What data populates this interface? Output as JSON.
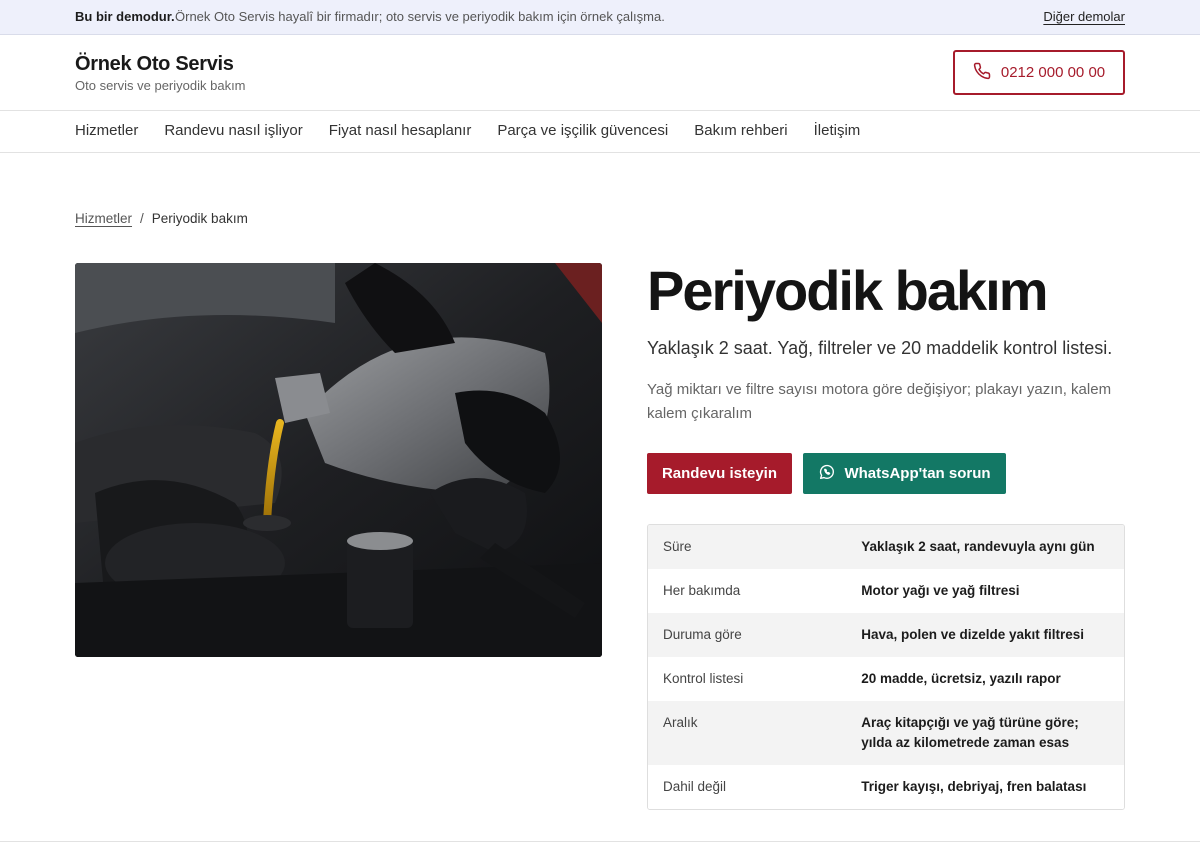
{
  "demo_bar": {
    "strong": "Bu bir demodur.",
    "note": "Örnek Oto Servis hayalî bir firmadır; oto servis ve periyodik bakım için örnek çalışma.",
    "other_link": "Diğer demolar"
  },
  "header": {
    "brand_title": "Örnek Oto Servis",
    "brand_sub": "Oto servis ve periyodik bakım",
    "phone": "0212 000 00 00",
    "phone_icon": "phone-icon"
  },
  "nav": {
    "items": [
      "Hizmetler",
      "Randevu nasıl işliyor",
      "Fiyat nasıl hesaplanır",
      "Parça ve işçilik güvencesi",
      "Bakım rehberi",
      "İletişim"
    ]
  },
  "breadcrumb": {
    "parent": "Hizmetler",
    "separator": "/",
    "current": "Periyodik bakım"
  },
  "main": {
    "title": "Periyodik bakım",
    "lead": "Yaklaşık 2 saat. Yağ, filtreler ve 20 maddelik kontrol listesi.",
    "desc": "Yağ miktarı ve filtre sayısı motora göre değişiyor; plakayı yazın, kalem kalem çıkaralım",
    "btn_primary": "Randevu isteyin",
    "btn_whatsapp": "WhatsApp'tan sorun",
    "whatsapp_icon": "whatsapp-icon"
  },
  "colors": {
    "accent_red": "#a61b2b",
    "accent_green": "#137865"
  },
  "table": {
    "rows": [
      {
        "key": "Süre",
        "value": "Yaklaşık 2 saat, randevuyla aynı gün"
      },
      {
        "key": "Her bakımda",
        "value": "Motor yağı ve yağ filtresi"
      },
      {
        "key": "Duruma göre",
        "value": "Hava, polen ve dizelde yakıt filtresi"
      },
      {
        "key": "Kontrol listesi",
        "value": "20 madde, ücretsiz, yazılı rapor"
      },
      {
        "key": "Aralık",
        "value": "Araç kitapçığı ve yağ türüne göre; yılda az kilometrede zaman esas"
      },
      {
        "key": "Dahil değil",
        "value": "Triger kayışı, debriyaj, fren balatası"
      }
    ]
  }
}
